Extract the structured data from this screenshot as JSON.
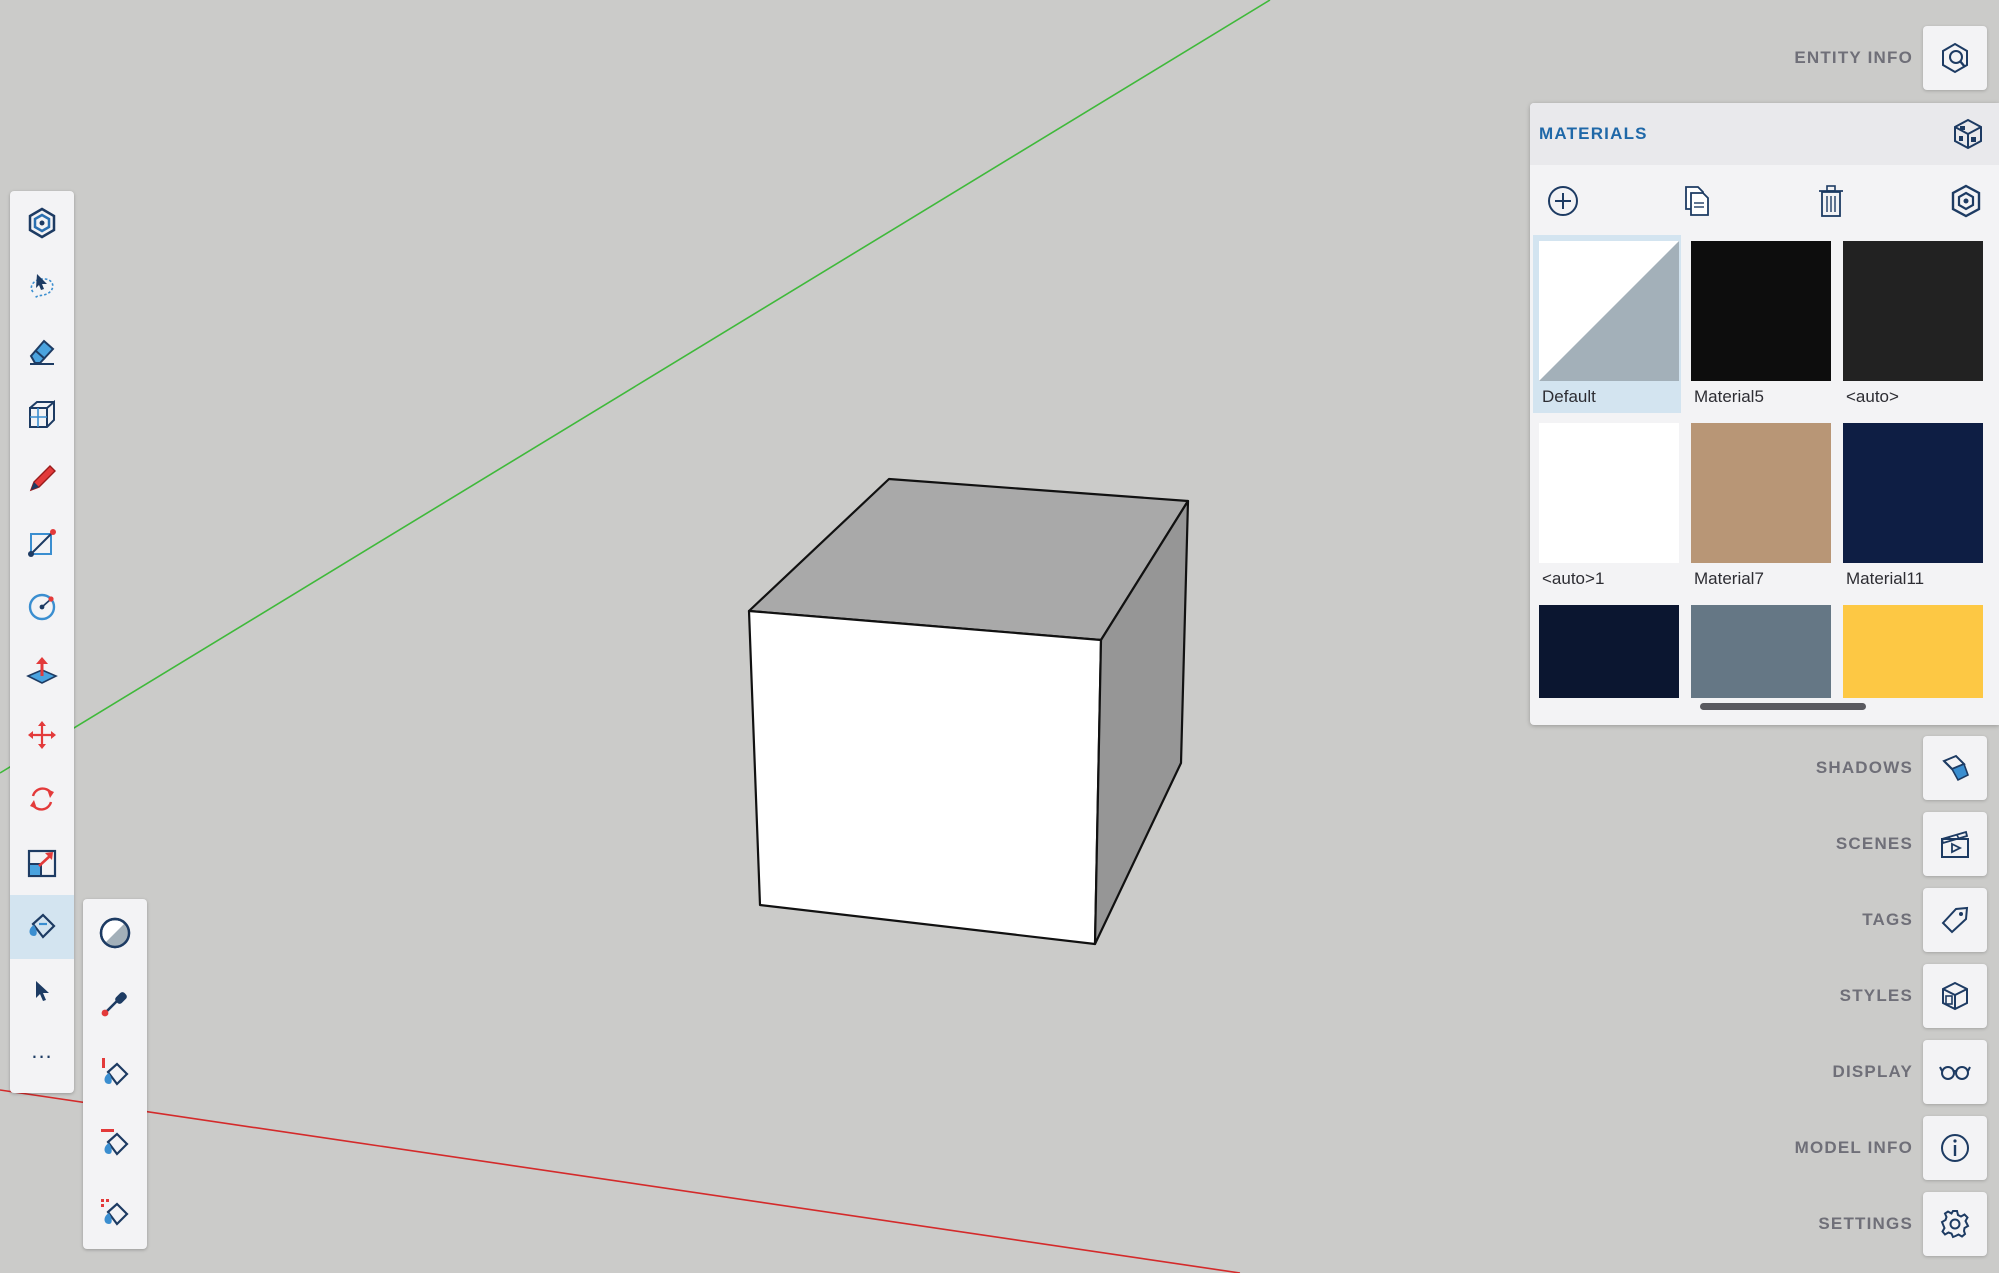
{
  "viewport": {
    "axis_colors": {
      "green": "#3fb93a",
      "red": "#d42a2a"
    },
    "cube_colors": {
      "top": "#a9a9a9",
      "front": "#ffffff",
      "side": "#969696",
      "edge": "#111111"
    }
  },
  "toolbar": {
    "active_tool": "paint-bucket",
    "tools": [
      "component-icon",
      "lasso-select-icon",
      "eraser-icon",
      "tape-section-icon",
      "pencil-icon",
      "line-icon",
      "circle-icon",
      "push-pull-icon",
      "move-icon",
      "rotate-icon",
      "scale-icon",
      "paint-bucket-icon",
      "select-arrow-icon",
      "more-icon"
    ],
    "more_label": "..."
  },
  "subtoolbar": {
    "tools": [
      "material-swatch-icon",
      "eyedropper-icon",
      "paint-fill-icon",
      "paint-replace-icon",
      "paint-adjacent-icon"
    ]
  },
  "panels": {
    "entity_info": "ENTITY INFO",
    "shadows": "SHADOWS",
    "scenes": "SCENES",
    "tags": "TAGS",
    "styles": "STYLES",
    "display": "DISPLAY",
    "model_info": "MODEL INFO",
    "settings": "SETTINGS"
  },
  "materials": {
    "title": "MATERIALS",
    "selected": "Default",
    "swatches": [
      {
        "label": "Default",
        "color": "#a3b0b9",
        "type": "default"
      },
      {
        "label": "Material5",
        "color": "#0d0d0d"
      },
      {
        "label": "<auto>",
        "color": "#222222"
      },
      {
        "label": "<auto>1",
        "color": "#ffffff"
      },
      {
        "label": "Material7",
        "color": "#b89676"
      },
      {
        "label": "Material11",
        "color": "#0e1e44"
      },
      {
        "label": "",
        "color": "#0b1630"
      },
      {
        "label": "",
        "color": "#657785"
      },
      {
        "label": "",
        "color": "#fdc844"
      }
    ]
  }
}
